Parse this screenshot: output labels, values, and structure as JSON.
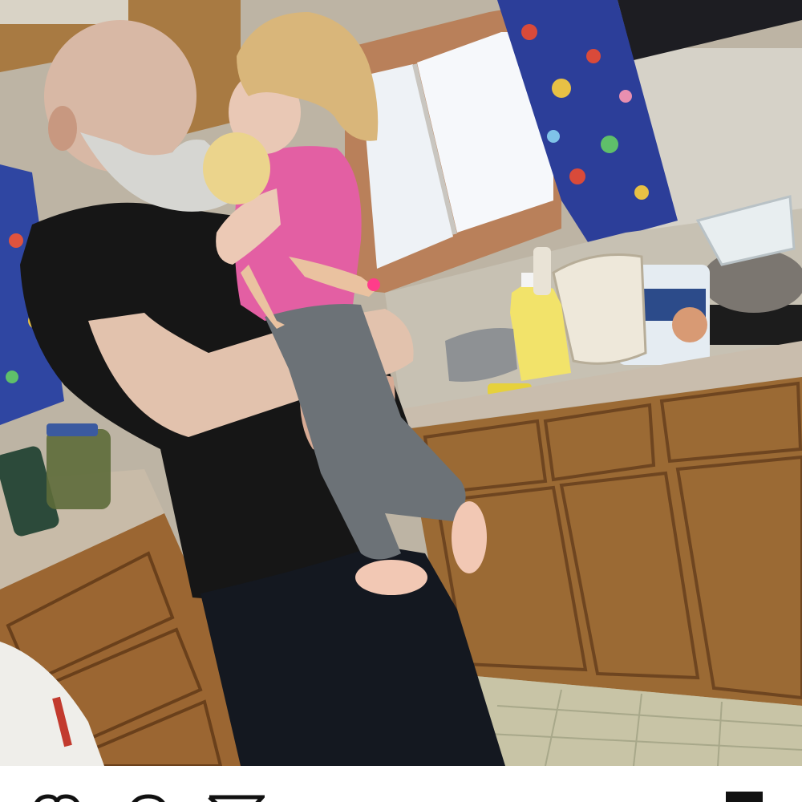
{
  "post": {
    "photo": {
      "subject": "kitchen-photo",
      "palette": {
        "wall": "#c9c2b4",
        "cabinet_wood": "#9a6a34",
        "counter": "#c8bba9",
        "window_light": "#f4f7fb",
        "curtain_blue": "#2d3f9c",
        "shirt_black": "#151515",
        "pink_shirt": "#e0569e",
        "floor": "#c8c4a6"
      }
    },
    "actions": {
      "like_icon": "heart-icon",
      "comment_icon": "comment-icon",
      "share_icon": "share-icon",
      "save_icon": "bookmark-icon"
    }
  }
}
